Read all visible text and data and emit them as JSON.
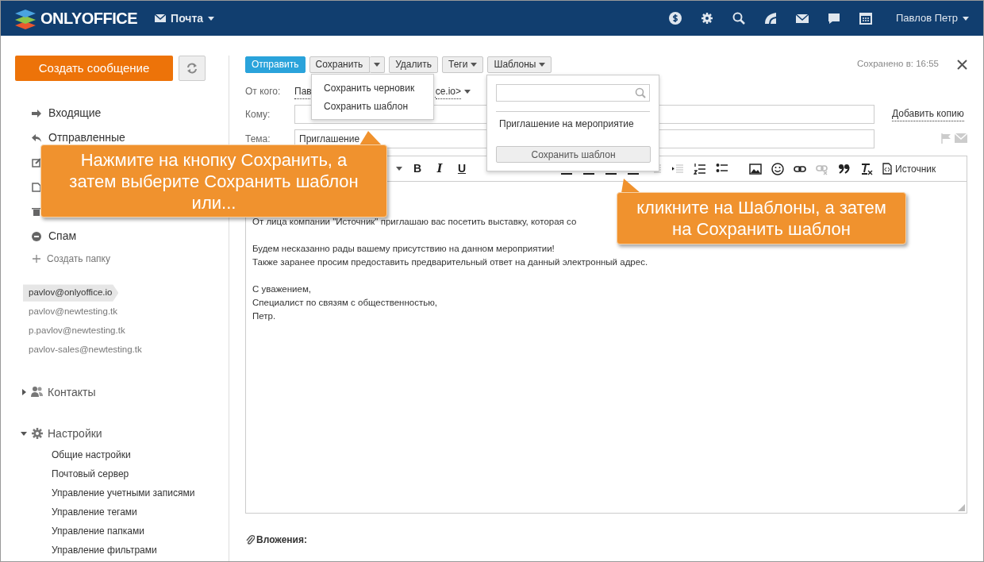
{
  "header": {
    "logo": "ONLYOFFICE",
    "module": "Почта",
    "user": "Павлов Петр"
  },
  "sidebar": {
    "compose": "Создать сообщение",
    "folders": [
      {
        "kind": "inbox",
        "label": "Входящие"
      },
      {
        "kind": "sent",
        "label": "Отправленные"
      },
      {
        "kind": "drafts"
      },
      {
        "kind": "templates"
      },
      {
        "kind": "trash"
      },
      {
        "kind": "spam",
        "label": "Спам"
      }
    ],
    "create_folder": "Создать папку",
    "accounts": [
      {
        "address": "pavlov@onlyoffice.io",
        "selected": true
      },
      {
        "address": "pavlov@newtesting.tk",
        "selected": false
      },
      {
        "address": "p.pavlov@newtesting.tk",
        "selected": false
      },
      {
        "address": "pavlov-sales@newtesting.tk",
        "selected": false
      }
    ],
    "sections": [
      {
        "kind": "contacts",
        "label": "Контакты",
        "expanded": false
      },
      {
        "kind": "settings",
        "label": "Настройки",
        "expanded": true,
        "children": [
          {
            "label": "Общие настройки"
          },
          {
            "label": "Почтовый сервер"
          },
          {
            "label": "Управление учетными записями"
          },
          {
            "label": "Управление тегами"
          },
          {
            "label": "Управление папками"
          },
          {
            "label": "Управление фильтрами"
          }
        ]
      }
    ]
  },
  "compose": {
    "toolbar": [
      {
        "kind": "primary",
        "label": "Отправить"
      },
      {
        "kind": "split",
        "label": "Сохранить"
      },
      {
        "kind": "plain",
        "label": "Удалить"
      },
      {
        "kind": "dropdown",
        "label": "Теги"
      },
      {
        "kind": "dropdown",
        "label": "Шаблоны"
      }
    ],
    "saved_at": "Сохранено в: 16:55",
    "from_label": "От кого:",
    "from_value_start": "Пав",
    "from_value_end": "ce.io>",
    "to_label": "Кому:",
    "add_copy": "Добавить копию",
    "subject_label": "Тема:",
    "subject": "Приглашение",
    "format_buttons": [
      "B",
      "I",
      "U"
    ],
    "source_button": "Источник",
    "body": [
      [
        "От лица компании \"Источник\" приглашаю вас посетить выставку, которая со"
      ],
      [
        "Будем несказанно рады вашему присутствию на данном мероприятии!",
        "Также заранее просим предоставить предварительный ответ на данный электронный адрес."
      ],
      [
        "С уважением,",
        "Специалист по связям с общественностью,",
        "Петр."
      ]
    ],
    "attachments_label": "Вложения:"
  },
  "save_menu": [
    {
      "label": "Сохранить черновик"
    },
    {
      "label": "Сохранить шаблон"
    }
  ],
  "templates_menu": {
    "items": [
      {
        "label": "Приглашение на мероприятие"
      }
    ],
    "button": "Сохранить шаблон"
  },
  "callouts": [
    {
      "text": "Нажмите на кнопку Сохранить, а затем выберите Сохранить шаблон или..."
    },
    {
      "text": "кликните на Шаблоны, а затем на Сохранить шаблон"
    }
  ]
}
